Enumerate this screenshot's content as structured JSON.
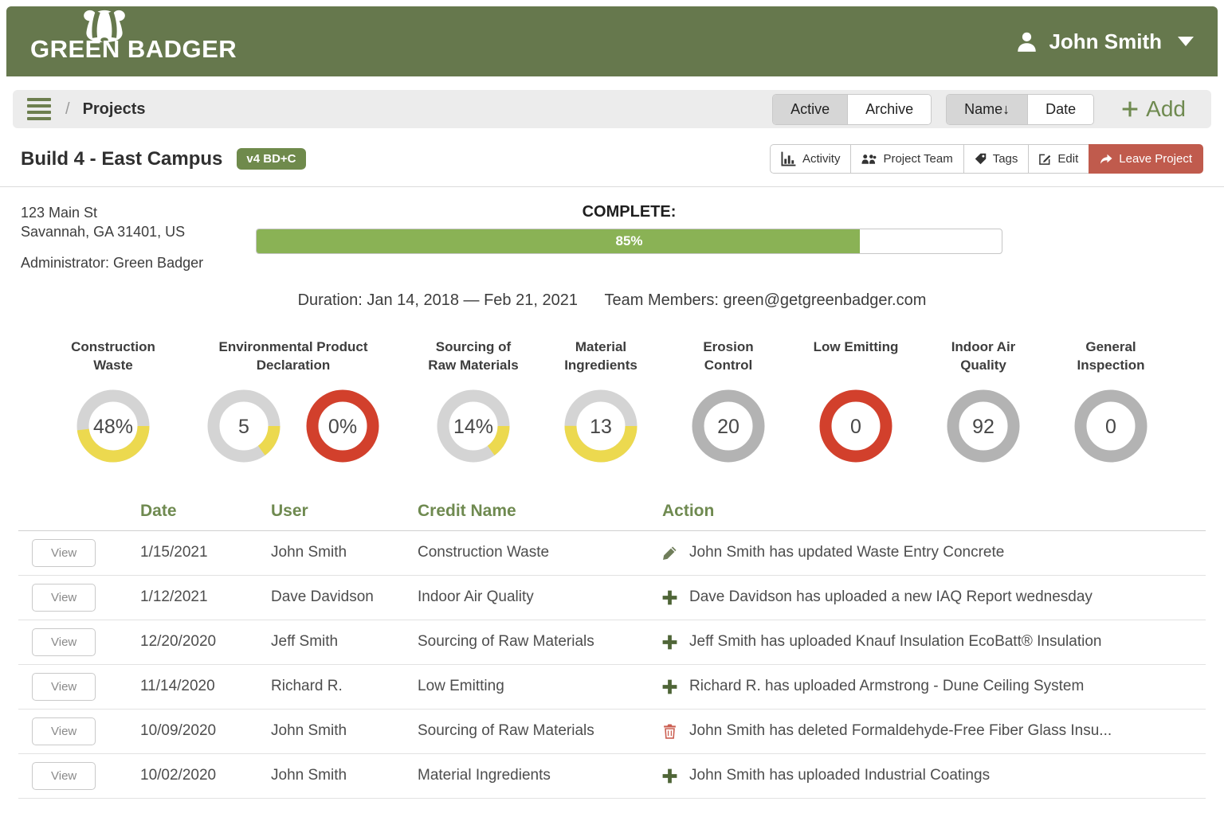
{
  "header": {
    "brand": "GREEN BADGER",
    "user_name": "John Smith"
  },
  "toolbar": {
    "breadcrumb_title": "Projects",
    "separator": "/",
    "active": "Active",
    "archive": "Archive",
    "sort_name": "Name↓",
    "sort_date": "Date",
    "add": "Add"
  },
  "project": {
    "title": "Build 4 - East Campus",
    "badge": "v4 BD+C",
    "address_line1": "123 Main St",
    "address_line2": "Savannah, GA 31401, US",
    "administrator": "Administrator: Green Badger",
    "complete_label": "COMPLETE:",
    "complete_value": "85%",
    "duration": "Duration: Jan 14, 2018 — Feb 21, 2021",
    "team_members": "Team Members: green@getgreenbadger.com",
    "actions": {
      "activity": "Activity",
      "project_team": "Project Team",
      "tags": "Tags",
      "edit": "Edit",
      "leave": "Leave Project"
    }
  },
  "gauges": [
    {
      "label": "Construction Waste",
      "donuts": [
        {
          "value": "48%",
          "fraction": 0.48,
          "color": "yellow"
        }
      ]
    },
    {
      "label": "Environmental Product Declaration",
      "donuts": [
        {
          "value": "5",
          "fraction": 0.15,
          "color": "yellow"
        },
        {
          "value": "0%",
          "fraction": 1,
          "color": "red"
        }
      ]
    },
    {
      "label": "Sourcing of Raw Materials",
      "donuts": [
        {
          "value": "14%",
          "fraction": 0.15,
          "color": "yellow"
        }
      ]
    },
    {
      "label": "Material Ingredients",
      "donuts": [
        {
          "value": "13",
          "fraction": 0.5,
          "color": "yellow"
        }
      ]
    },
    {
      "label": "Erosion Control",
      "donuts": [
        {
          "value": "20",
          "fraction": 1,
          "color": "gray"
        }
      ]
    },
    {
      "label": "Low Emitting",
      "donuts": [
        {
          "value": "0",
          "fraction": 1,
          "color": "red"
        }
      ]
    },
    {
      "label": "Indoor Air Quality",
      "donuts": [
        {
          "value": "92",
          "fraction": 1,
          "color": "gray"
        }
      ]
    },
    {
      "label": "General Inspection",
      "donuts": [
        {
          "value": "0",
          "fraction": 1,
          "color": "gray"
        }
      ]
    }
  ],
  "table": {
    "headers": [
      "Date",
      "User",
      "Credit Name",
      "Action"
    ],
    "view_label": "View",
    "rows": [
      {
        "date": "1/15/2021",
        "user": "John Smith",
        "credit": "Construction Waste",
        "icon": "pencil",
        "action": "John Smith has updated Waste Entry Concrete"
      },
      {
        "date": "1/12/2021",
        "user": "Dave Davidson",
        "credit": "Indoor Air Quality",
        "icon": "plus",
        "action": "Dave Davidson has uploaded a new IAQ Report wednesday"
      },
      {
        "date": "12/20/2020",
        "user": "Jeff Smith",
        "credit": "Sourcing of Raw Materials",
        "icon": "plus",
        "action": "Jeff Smith has uploaded Knauf Insulation EcoBatt® Insulation"
      },
      {
        "date": "11/14/2020",
        "user": "Richard R.",
        "credit": "Low Emitting",
        "icon": "plus",
        "action": "Richard R. has uploaded Armstrong - Dune Ceiling System"
      },
      {
        "date": "10/09/2020",
        "user": "John Smith",
        "credit": "Sourcing of Raw Materials",
        "icon": "trash",
        "action": "John Smith has deleted Formaldehyde-Free Fiber Glass Insu..."
      },
      {
        "date": "10/02/2020",
        "user": "John Smith",
        "credit": "Material Ingredients",
        "icon": "plus",
        "action": "John Smith has uploaded Industrial Coatings"
      }
    ]
  },
  "icons": {
    "brand": "badger-icon",
    "user": "person-icon",
    "menu": "hamburger-icon",
    "add": "plus-icon",
    "activity": "bar-chart-icon",
    "project_team": "people-icon",
    "tags": "tag-icon",
    "edit": "edit-pencil-icon",
    "leave": "share-arrow-icon",
    "row_update": "pencil-icon",
    "row_upload": "plus-icon",
    "row_delete": "trash-icon"
  },
  "colors": {
    "header_bg": "#66784d",
    "accent_green": "#6f8a50",
    "progress_green": "#8ab255",
    "badge_green": "#6f8a4c",
    "leave_red": "#c05b4d",
    "ring_red": "#d2402c",
    "ring_yellow": "#ecd94f",
    "ring_gray": "#b3b3b3",
    "ring_track": "#d4d4d4",
    "icon_green": "#4f6537",
    "icon_olive": "#6f7d5a",
    "icon_trash": "#cb5f52"
  }
}
